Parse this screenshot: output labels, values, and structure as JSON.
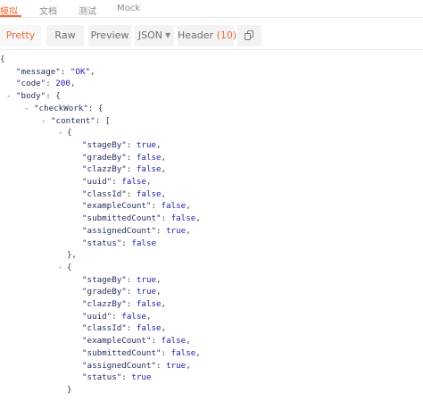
{
  "tabs": [
    {
      "label": "模拟",
      "active": true
    },
    {
      "label": "文档",
      "active": false
    },
    {
      "label": "测试",
      "active": false
    },
    {
      "label": "Mock",
      "active": false
    }
  ],
  "toolbar": {
    "pretty": "Pretty",
    "raw": "Raw",
    "preview": "Preview",
    "format": "JSON",
    "header_label": "Header",
    "header_count": "(10)",
    "copy_icon": "copy-icon"
  },
  "colors": {
    "accent": "#f26b3a",
    "key": "#23305e",
    "value": "#2222aa"
  },
  "json": {
    "message_key": "\"message\"",
    "message_value": "\"OK\"",
    "code_key": "\"code\"",
    "code_value": "200",
    "body_key": "\"body\"",
    "checkwork_key": "\"checkWork\"",
    "content_key": "\"content\"",
    "fold_marker": "-",
    "items": [
      [
        {
          "key": "\"stageBy\"",
          "value": "true"
        },
        {
          "key": "\"gradeBy\"",
          "value": "false"
        },
        {
          "key": "\"clazzBy\"",
          "value": "false"
        },
        {
          "key": "\"uuid\"",
          "value": "false"
        },
        {
          "key": "\"classId\"",
          "value": "false"
        },
        {
          "key": "\"exampleCount\"",
          "value": "false"
        },
        {
          "key": "\"submittedCount\"",
          "value": "false"
        },
        {
          "key": "\"assignedCount\"",
          "value": "true"
        },
        {
          "key": "\"status\"",
          "value": "false"
        }
      ],
      [
        {
          "key": "\"stageBy\"",
          "value": "true"
        },
        {
          "key": "\"gradeBy\"",
          "value": "true"
        },
        {
          "key": "\"clazzBy\"",
          "value": "false"
        },
        {
          "key": "\"uuid\"",
          "value": "false"
        },
        {
          "key": "\"classId\"",
          "value": "false"
        },
        {
          "key": "\"exampleCount\"",
          "value": "false"
        },
        {
          "key": "\"submittedCount\"",
          "value": "false"
        },
        {
          "key": "\"assignedCount\"",
          "value": "true"
        },
        {
          "key": "\"status\"",
          "value": "true"
        }
      ]
    ]
  }
}
